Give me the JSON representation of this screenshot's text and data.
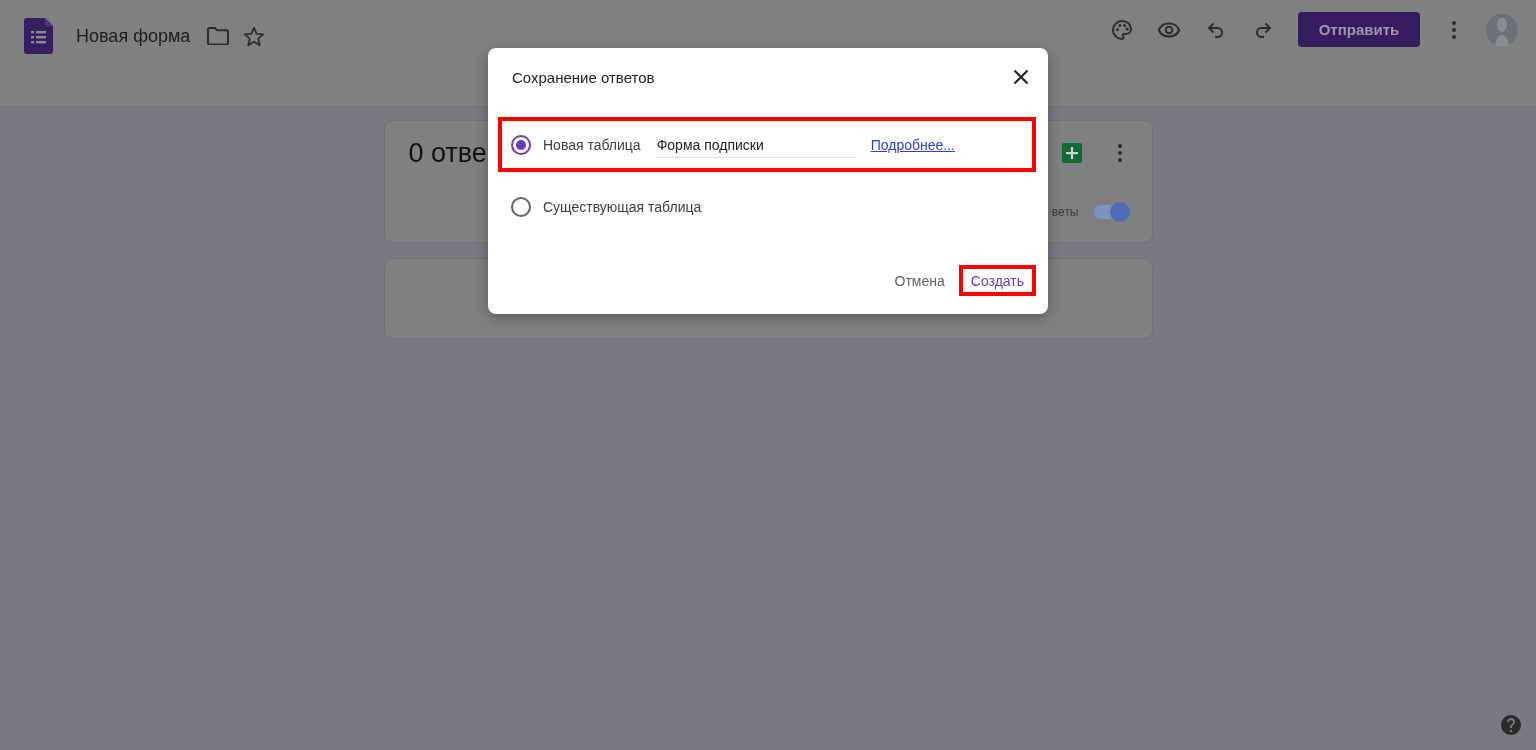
{
  "header": {
    "title": "Новая форма",
    "send_button": "Отправить"
  },
  "responses_card": {
    "count_text": "0 отве",
    "accepting_label": "веты",
    "accepting_on": true
  },
  "dialog": {
    "title": "Сохранение ответов",
    "options": [
      {
        "kind": "new",
        "label": "Новая таблица",
        "selected": true,
        "highlighted": true,
        "field_value": "Форма подписки",
        "link": "Подробнее..."
      },
      {
        "kind": "existing",
        "label": "Существующая таблица",
        "selected": false,
        "highlighted": false
      }
    ],
    "buttons": [
      {
        "kind": "text",
        "label": "Отмена",
        "highlighted": false
      },
      {
        "kind": "primary",
        "label": "Создать",
        "highlighted": true
      }
    ]
  }
}
